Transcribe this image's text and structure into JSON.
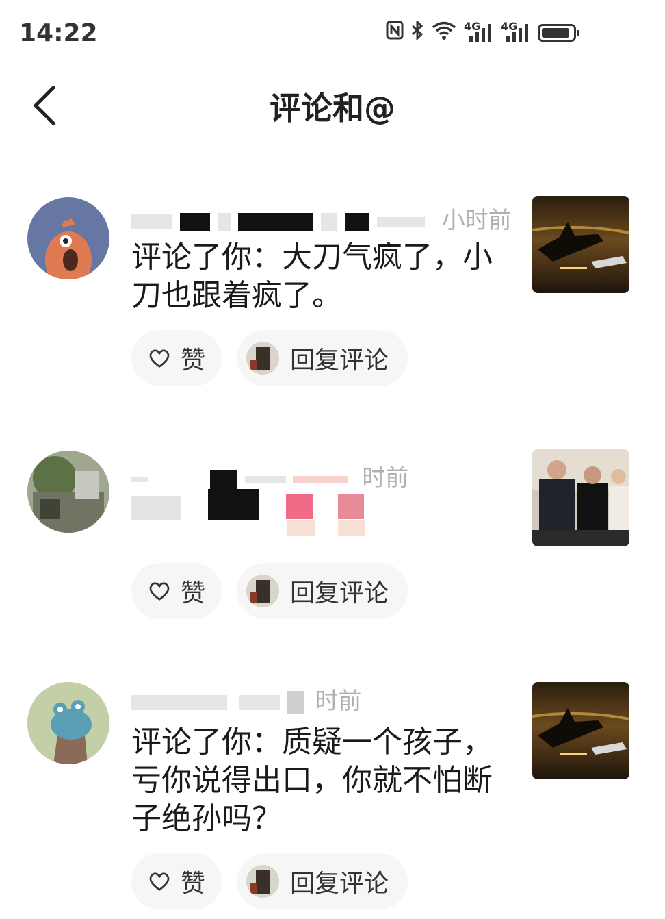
{
  "status_bar": {
    "time": "14:22",
    "icons": [
      "nfc-icon",
      "bluetooth-icon",
      "wifi-icon",
      "signal-4g-icon",
      "signal-4g-icon",
      "battery-icon"
    ],
    "network_labels": [
      "4G",
      "4G"
    ]
  },
  "header": {
    "title": "评论和@"
  },
  "comments": [
    {
      "time_suffix": "小时前",
      "text": "评论了你：大刀气疯了，小刀也跟着疯了。",
      "like_label": "赞",
      "reply_label": "回复评论"
    },
    {
      "time_suffix": "时前",
      "text": "",
      "like_label": "赞",
      "reply_label": "回复评论"
    },
    {
      "time_suffix": "时前",
      "text": "评论了你：质疑一个孩子，亏你说得出口，你就不怕断子绝孙吗？",
      "like_label": "赞",
      "reply_label": "回复评论"
    }
  ],
  "colors": {
    "meta_gray": "#b0b0b0",
    "pill_bg": "#f6f6f6",
    "text": "#1a1a1a"
  }
}
